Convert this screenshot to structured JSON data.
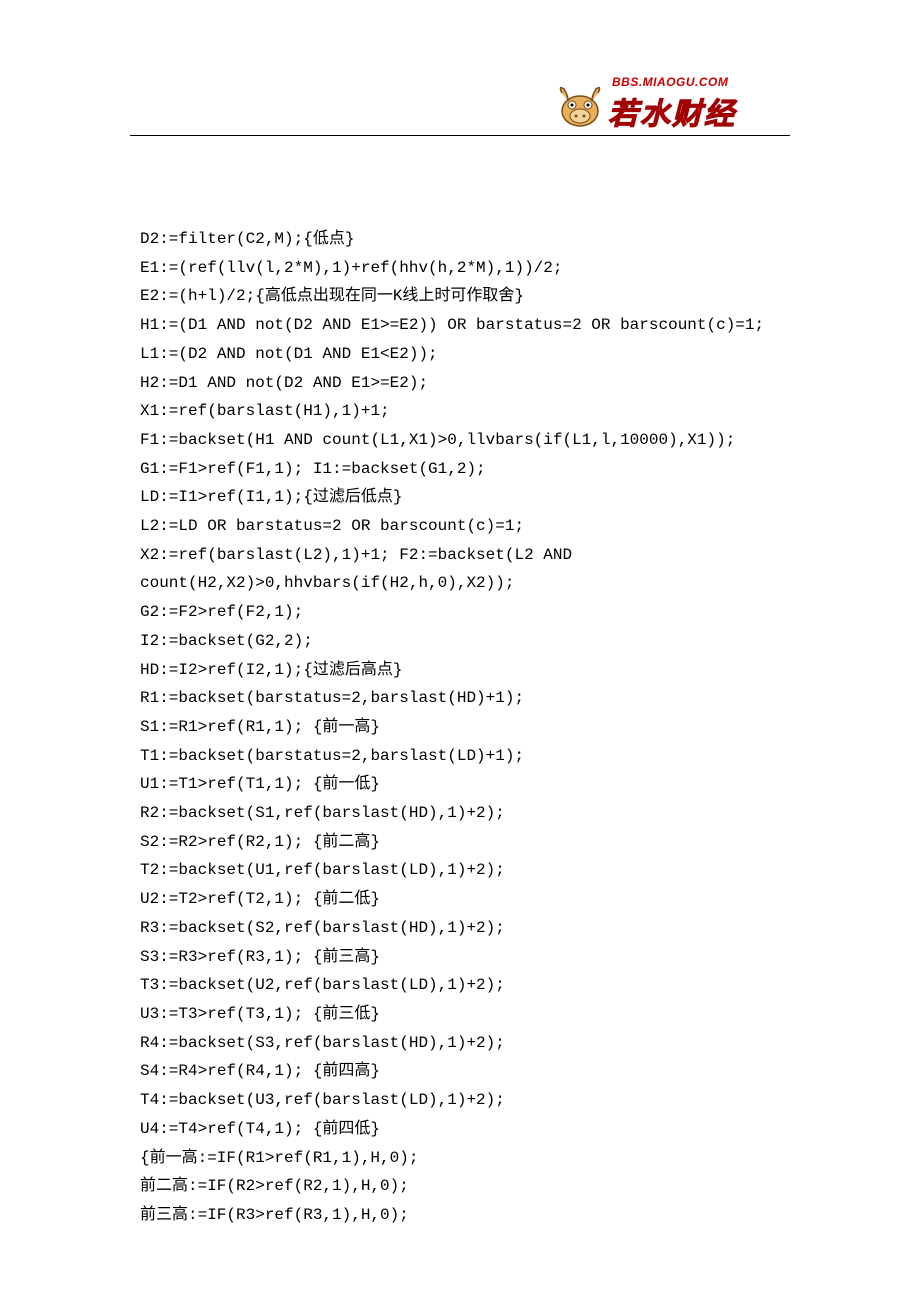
{
  "header": {
    "url": "BBS.MIAOGU.COM",
    "brand": "若水财经"
  },
  "code_lines": [
    "D2:=filter(C2,M);{低点}",
    "E1:=(ref(llv(l,2*M),1)+ref(hhv(h,2*M),1))/2;",
    "E2:=(h+l)/2;{高低点出现在同一K线上时可作取舍}",
    "H1:=(D1 AND not(D2 AND E1>=E2)) OR barstatus=2 OR barscount(c)=1;",
    "L1:=(D2 AND not(D1 AND E1<E2));",
    "H2:=D1 AND not(D2 AND E1>=E2);",
    "X1:=ref(barslast(H1),1)+1;",
    "F1:=backset(H1 AND count(L1,X1)>0,llvbars(if(L1,l,10000),X1));",
    "G1:=F1>ref(F1,1); I1:=backset(G1,2);",
    "LD:=I1>ref(I1,1);{过滤后低点}",
    "L2:=LD OR barstatus=2 OR barscount(c)=1;",
    "X2:=ref(barslast(L2),1)+1; F2:=backset(L2 AND",
    "count(H2,X2)>0,hhvbars(if(H2,h,0),X2));",
    "G2:=F2>ref(F2,1);",
    "I2:=backset(G2,2);",
    "HD:=I2>ref(I2,1);{过滤后高点}",
    "R1:=backset(barstatus=2,barslast(HD)+1);",
    "S1:=R1>ref(R1,1); {前一高}",
    "T1:=backset(barstatus=2,barslast(LD)+1);",
    "U1:=T1>ref(T1,1); {前一低}",
    "R2:=backset(S1,ref(barslast(HD),1)+2);",
    "S2:=R2>ref(R2,1); {前二高}",
    "T2:=backset(U1,ref(barslast(LD),1)+2);",
    "U2:=T2>ref(T2,1); {前二低}",
    "R3:=backset(S2,ref(barslast(HD),1)+2);",
    "S3:=R3>ref(R3,1); {前三高}",
    "T3:=backset(U2,ref(barslast(LD),1)+2);",
    "U3:=T3>ref(T3,1); {前三低}",
    "R4:=backset(S3,ref(barslast(HD),1)+2);",
    "S4:=R4>ref(R4,1); {前四高}",
    "T4:=backset(U3,ref(barslast(LD),1)+2);",
    "U4:=T4>ref(T4,1); {前四低}",
    "{前一高:=IF(R1>ref(R1,1),H,0);",
    "前二高:=IF(R2>ref(R2,1),H,0);",
    "前三高:=IF(R3>ref(R3,1),H,0);"
  ]
}
